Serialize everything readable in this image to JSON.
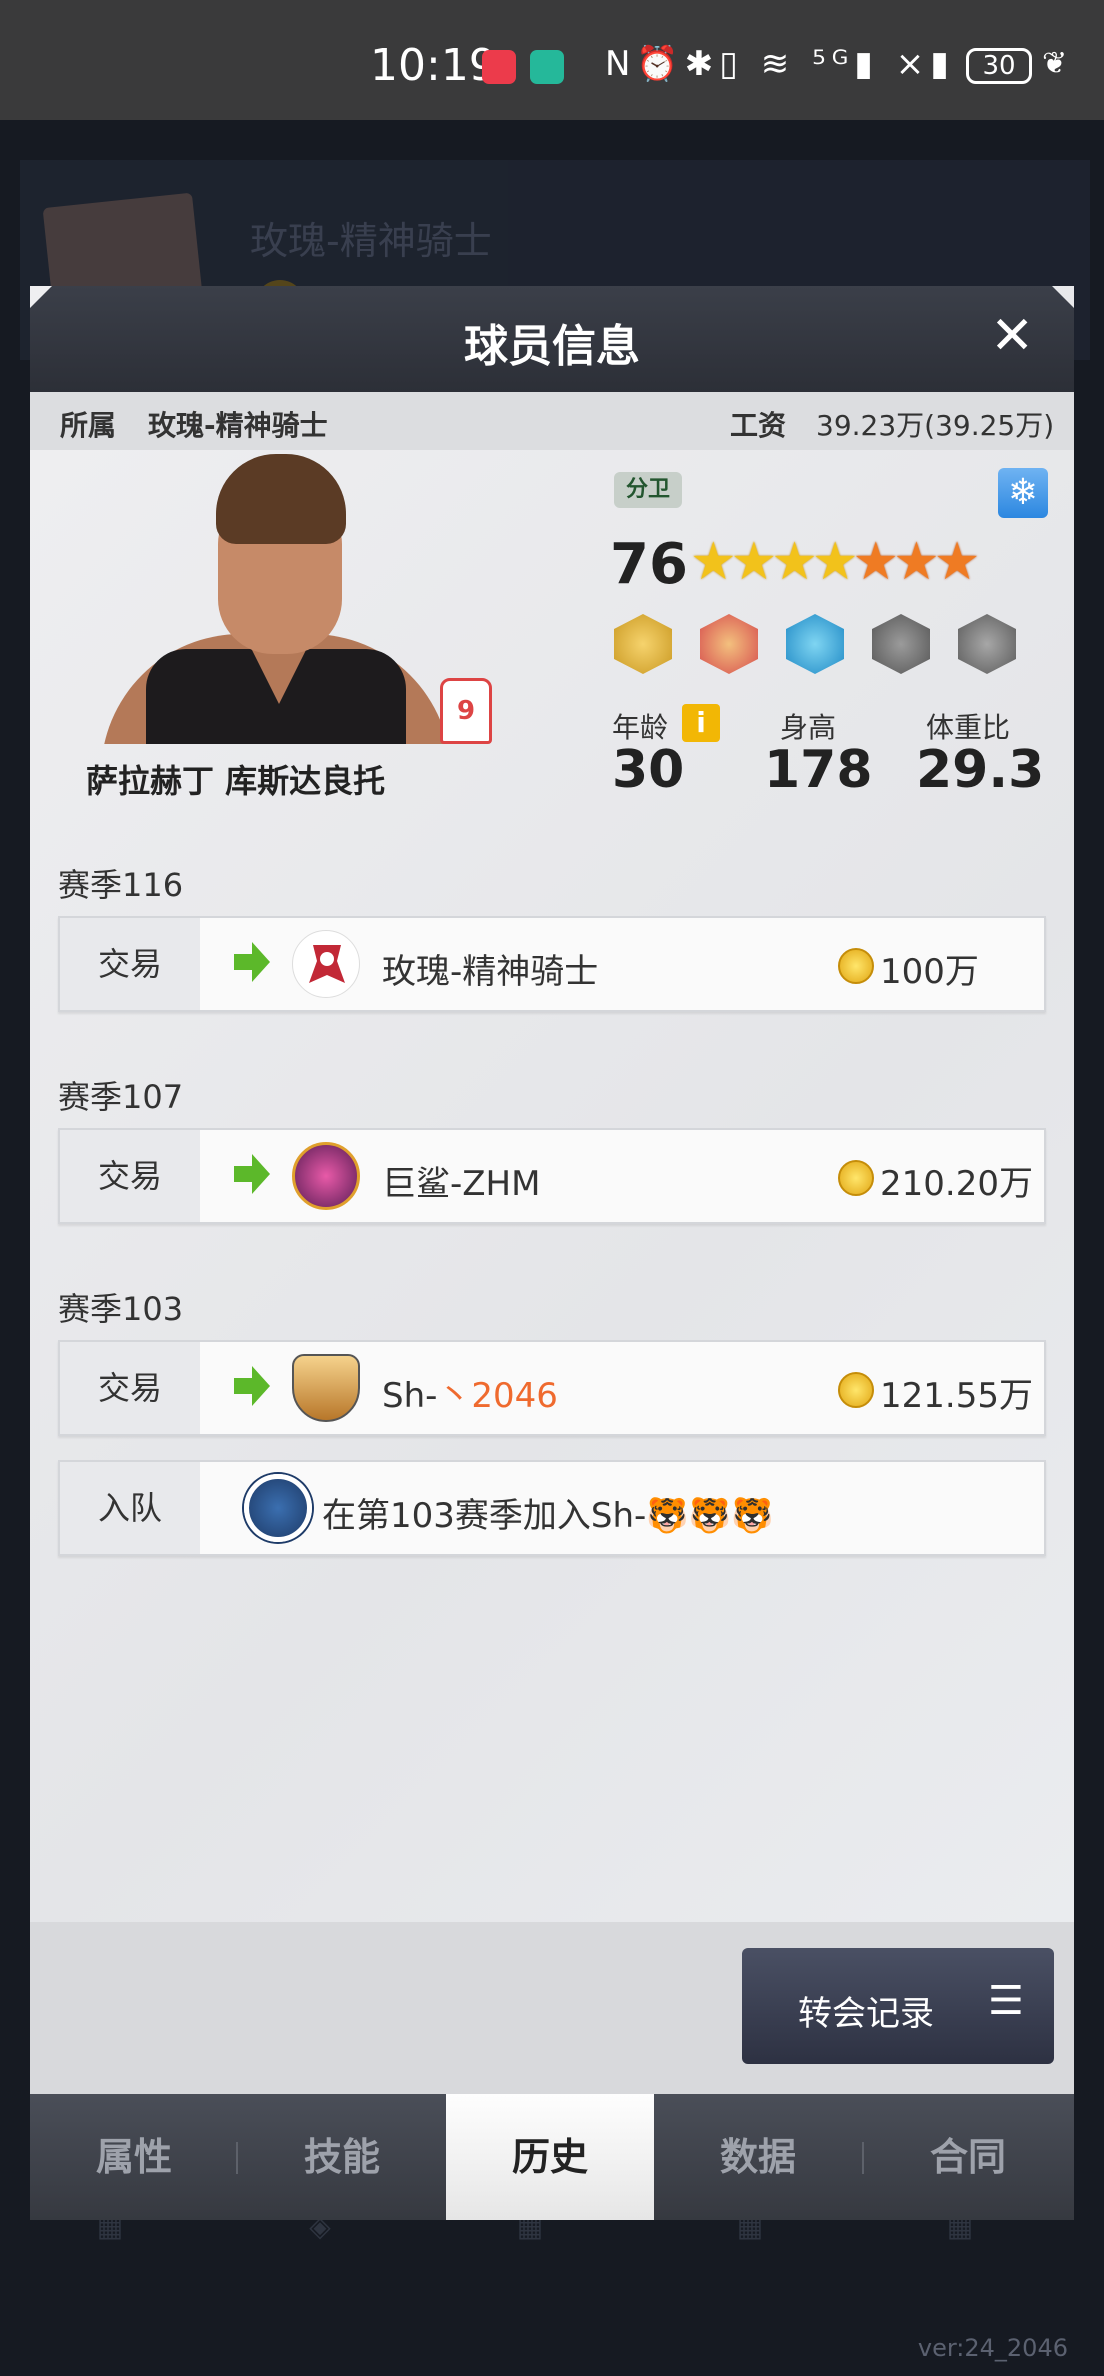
{
  "status_bar": {
    "time": "10:19",
    "icons_text": "N⏰✱▯ ≋ ⁵ᴳ▮ ×▮",
    "battery": "30"
  },
  "background": {
    "team_title": "玫瑰-精神骑士",
    "version": "ver:24_2046"
  },
  "modal": {
    "title": "球员信息",
    "close_icon": "✕",
    "info": {
      "team_label": "所属",
      "team_value": "玫瑰-精神骑士",
      "salary_label": "工资",
      "salary_value": "39.23万(39.25万)"
    },
    "player": {
      "name": "萨拉赫丁 库斯达良托",
      "jersey_number": "9",
      "position": "分卫",
      "rating": "76",
      "stars_gold": 4,
      "stars_orange": 3,
      "age_label": "年龄",
      "age": "30",
      "height_label": "身高",
      "height": "178",
      "weight_ratio_label": "体重比",
      "weight_ratio": "29.3"
    },
    "history": [
      {
        "season": "赛季116",
        "type": "交易",
        "team": "玫瑰-精神骑士",
        "fee": "100万",
        "logo_color": "#ffffff"
      },
      {
        "season": "赛季107",
        "type": "交易",
        "team": "巨鲨-ZHM",
        "fee": "210.20万",
        "logo_color": "#7a2a6f"
      },
      {
        "season": "赛季103",
        "type": "交易",
        "team_prefix": "Sh-",
        "team_highlight": "丶2046",
        "fee": "121.55万",
        "logo_color": "#e8b35e"
      },
      {
        "type": "入队",
        "text": "在第103赛季加入Sh-🐯🐯🐯",
        "logo_color": "#1e3b68"
      }
    ],
    "transfer_button": "转会记录",
    "tabs": [
      "属性",
      "技能",
      "历史",
      "数据",
      "合同"
    ],
    "active_tab": "历史"
  },
  "colors": {
    "accent_orange": "#ef6a2e",
    "arrow_green": "#5cb82a",
    "header_dark": "#2c2f37"
  }
}
